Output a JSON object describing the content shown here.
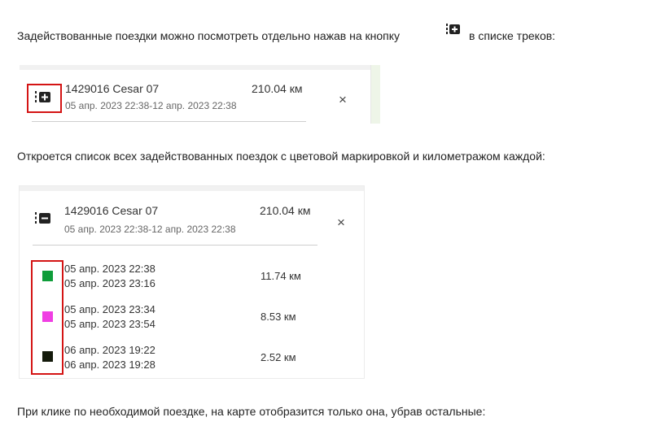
{
  "para1_before": "Задействованные поездки можно посмотреть отдельно нажав на кнопку",
  "para1_after": "в списке треков:",
  "para2": "Откроется список всех задействованных поездок с цветовой маркировкой и километражом каждой:",
  "para3": "При клике по необходимой поездке, на карте отобразится только она, убрав остальные:",
  "track": {
    "name": "1429016 Cesar 07",
    "dates": "05 апр. 2023 22:38-12 апр. 2023 22:38",
    "distance": "210.04 км",
    "close": "×"
  },
  "trips": [
    {
      "start": "05 апр. 2023 22:38",
      "end": "05 апр. 2023 23:16",
      "distance": "11.74 км",
      "color": "#0f9d3a"
    },
    {
      "start": "05 апр. 2023 23:34",
      "end": "05 апр. 2023 23:54",
      "distance": "8.53 км",
      "color": "#f03ee3"
    },
    {
      "start": "06 апр. 2023 19:22",
      "end": "06 апр. 2023 19:28",
      "distance": "2.52 км",
      "color": "#141a0b"
    }
  ],
  "icons": {
    "expand": "expand-trips-icon",
    "collapse": "collapse-trips-icon"
  },
  "highlight_color": "#d41414"
}
